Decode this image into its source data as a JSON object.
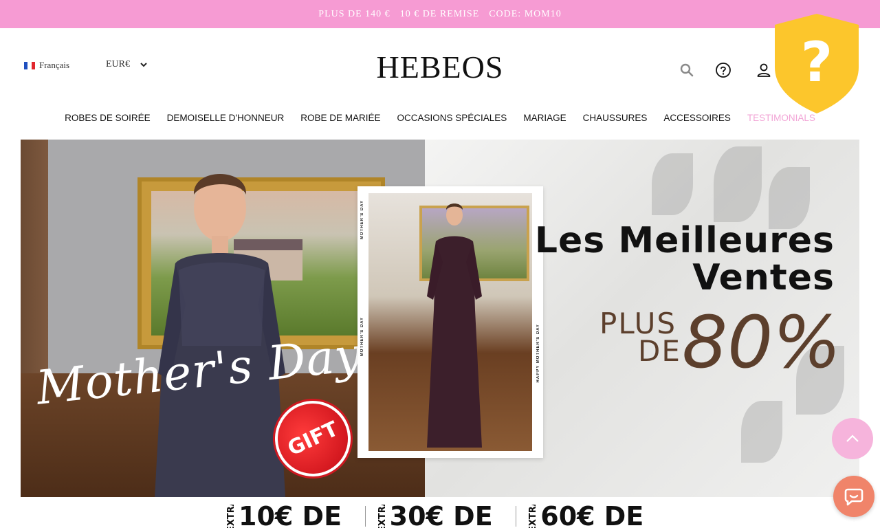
{
  "promo": {
    "text_1": "PLUS DE 140 €",
    "text_2": "10 € DE REMISE",
    "text_3": "CODE: MOM10"
  },
  "header": {
    "language": "Français",
    "currency": "EUR€",
    "logo": "HEBEOS",
    "icons": [
      "search-icon",
      "help-icon",
      "account-icon"
    ]
  },
  "trust_badge": {
    "icon": "question-mark-shield-icon",
    "glyph": "?",
    "color": "#fcc62c"
  },
  "nav": {
    "items": [
      "ROBES DE SOIRÉE",
      "DEMOISELLE D'HONNEUR",
      "ROBE DE MARIÉE",
      "OCCASIONS SPÉCIALES",
      "MARIAGE",
      "CHAUSSURES",
      "ACCESSOIRES",
      "TESTIMONIALS"
    ],
    "highlight_color": "#f2a4d6"
  },
  "hero": {
    "script_text": "Mother's Day",
    "gift_badge": "GIFT",
    "headline_line1": "Les Meilleures",
    "headline_line2": "Ventes",
    "plus": "PLUS",
    "de": "DE",
    "percent": "80%",
    "polaroid_caption": "MOTHER'S DAY",
    "polaroid_caption_2": "HAPPY MOTHER'S DAY"
  },
  "coupons": [
    {
      "prefix": "EXTRA",
      "amount": "10€ DE"
    },
    {
      "prefix": "EXTRA",
      "amount": "30€ DE"
    },
    {
      "prefix": "EXTRA",
      "amount": "60€ DE"
    }
  ],
  "colors": {
    "promo_bg": "#f69bd3",
    "accent_brown": "#5c3f2c",
    "scroll_top_bg": "#f6b4dc",
    "chat_bg": "#f0846a"
  }
}
